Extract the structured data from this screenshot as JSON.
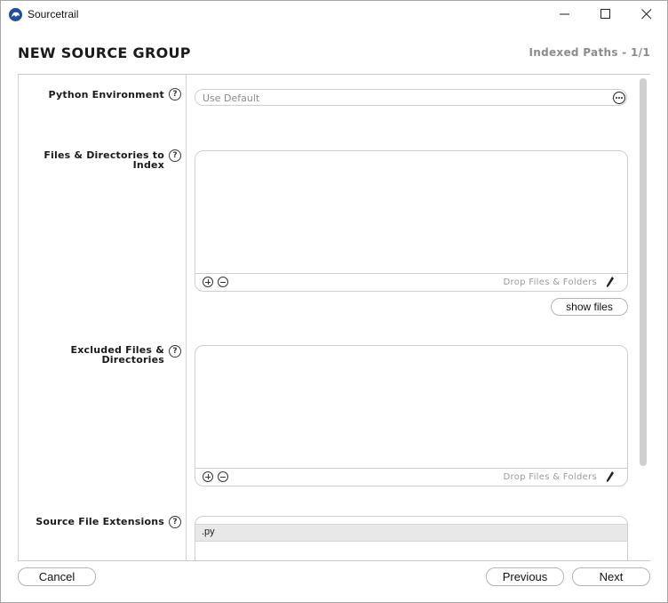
{
  "window": {
    "app_title": "Sourcetrail",
    "icons": {
      "app": "sourcetrail-logo-icon",
      "minimize": "minimize-icon",
      "maximize": "maximize-icon",
      "close": "close-icon"
    }
  },
  "header": {
    "title": "NEW SOURCE GROUP",
    "progress": "Indexed Paths - 1/1"
  },
  "form": {
    "python_environment": {
      "label": "Python Environment",
      "placeholder": "Use Default"
    },
    "files_to_index": {
      "label_line1": "Files & Directories to",
      "label_line2": "Index",
      "drop_hint": "Drop Files & Folders",
      "items": []
    },
    "show_files_label": "show files",
    "excluded": {
      "label_line1": "Excluded Files &",
      "label_line2": "Directories",
      "drop_hint": "Drop Files & Folders",
      "items": []
    },
    "extensions": {
      "label": "Source File Extensions",
      "items": [
        ".py"
      ]
    },
    "help_glyph": "?"
  },
  "footer": {
    "cancel": "Cancel",
    "previous": "Previous",
    "next": "Next"
  },
  "colors": {
    "app_icon": "#1f4f9e",
    "border": "#cfcfcf",
    "muted_text": "#8c8c8c",
    "scrollbar": "#cfcfcf"
  }
}
